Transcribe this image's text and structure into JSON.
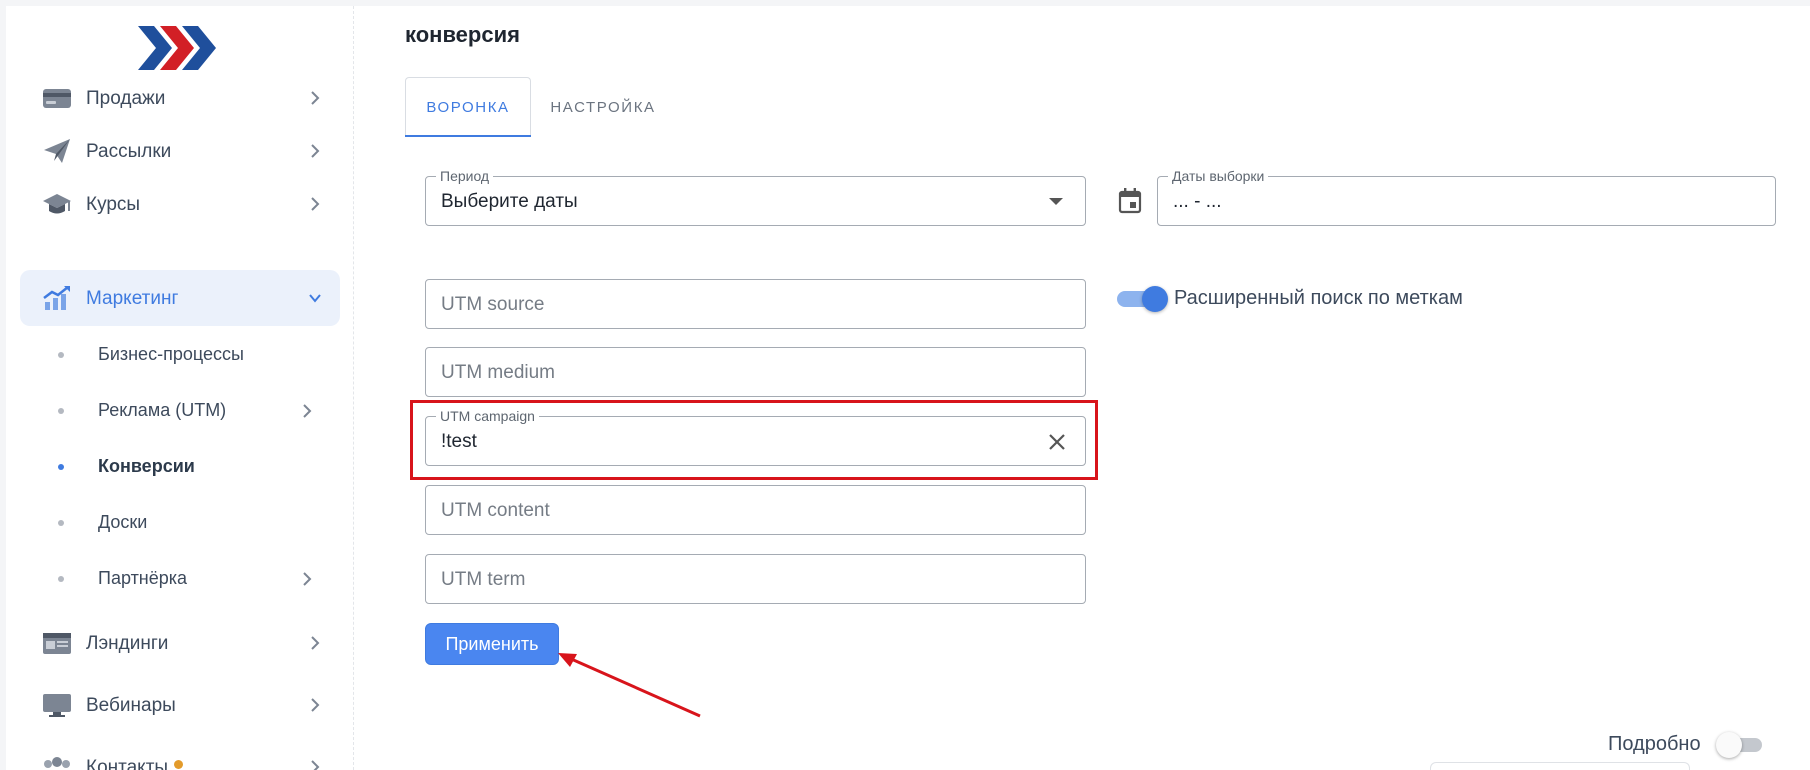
{
  "sidebar": {
    "items": [
      {
        "label": "Продажи",
        "icon": "credit-card-icon"
      },
      {
        "label": "Рассылки",
        "icon": "paper-plane-icon"
      },
      {
        "label": "Курсы",
        "icon": "graduation-cap-icon"
      },
      {
        "label": "Маркетинг",
        "icon": "chart-growth-icon",
        "expanded": true
      },
      {
        "label": "Лэндинги",
        "icon": "browser-window-icon"
      },
      {
        "label": "Вебинары",
        "icon": "monitor-icon"
      },
      {
        "label": "Контакты",
        "icon": "users-icon",
        "badge": true
      }
    ],
    "sub_items": [
      {
        "label": "Бизнес-процессы"
      },
      {
        "label": "Реклама (UTM)"
      },
      {
        "label": "Конверсии",
        "current": true
      },
      {
        "label": "Доски"
      },
      {
        "label": "Партнёрка"
      }
    ]
  },
  "main": {
    "title": "конверсия",
    "tabs": [
      {
        "label": "ВОРОНКА",
        "active": true
      },
      {
        "label": "НАСТРОЙКА",
        "active": false
      }
    ],
    "period": {
      "label": "Период",
      "value": "Выберите даты"
    },
    "dates": {
      "label": "Даты выборки",
      "value": "... - ..."
    },
    "utm": {
      "source": {
        "placeholder": "UTM source"
      },
      "medium": {
        "placeholder": "UTM medium"
      },
      "campaign": {
        "label": "UTM campaign",
        "value": "!test"
      },
      "content": {
        "placeholder": "UTM content"
      },
      "term": {
        "placeholder": "UTM term"
      }
    },
    "extended_search": {
      "label": "Расширенный поиск по меткам",
      "enabled": true
    },
    "apply_label": "Применить",
    "detail": {
      "label": "Подробно",
      "enabled": false
    }
  },
  "colors": {
    "accent": "#3f7be0",
    "highlight": "#d8141b",
    "badge": "#e39b2b"
  }
}
